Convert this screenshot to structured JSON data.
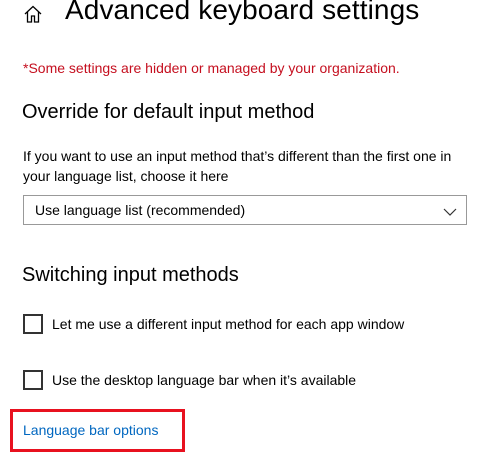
{
  "header": {
    "title": "Advanced keyboard settings",
    "home_icon": "home-icon"
  },
  "org_warning": "*Some settings are hidden or managed by your organization.",
  "override_section": {
    "title": "Override for default input method",
    "description": "If you want to use an input method that’s different than the first one in your language list, choose it here",
    "dropdown": {
      "selected": "Use language list (recommended)",
      "icon": "chevron-down-icon"
    }
  },
  "switching_section": {
    "title": "Switching input methods",
    "checkboxes": [
      {
        "label": "Let me use a different input method for each app window",
        "checked": false
      },
      {
        "label": "Use the desktop language bar when it’s available",
        "checked": false
      }
    ],
    "link": "Language bar options"
  },
  "colors": {
    "warning": "#c50f1f",
    "link": "#0067c0",
    "highlight": "#e8111f"
  }
}
